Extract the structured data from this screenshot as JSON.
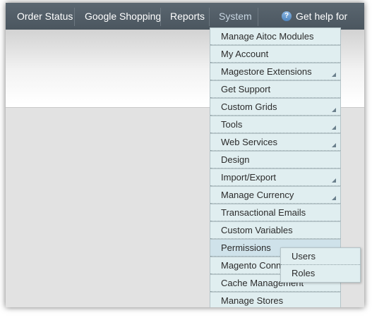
{
  "nav": {
    "order_status": "Order Status",
    "google_shopping": "Google Shopping",
    "reports": "Reports",
    "system": "System",
    "help": "Get help for",
    "help_icon_glyph": "?",
    "help_icon": "help-circle-icon"
  },
  "system_menu": {
    "items": [
      {
        "label": "Manage Aitoc Modules",
        "has_submenu": false
      },
      {
        "label": "My Account",
        "has_submenu": false
      },
      {
        "label": "Magestore Extensions",
        "has_submenu": true
      },
      {
        "label": "Get Support",
        "has_submenu": false
      },
      {
        "label": "Custom Grids",
        "has_submenu": true
      },
      {
        "label": "Tools",
        "has_submenu": true
      },
      {
        "label": "Web Services",
        "has_submenu": true
      },
      {
        "label": "Design",
        "has_submenu": false
      },
      {
        "label": "Import/Export",
        "has_submenu": true
      },
      {
        "label": "Manage Currency",
        "has_submenu": true
      },
      {
        "label": "Transactional Emails",
        "has_submenu": false
      },
      {
        "label": "Custom Variables",
        "has_submenu": false
      },
      {
        "label": "Permissions",
        "has_submenu": true
      },
      {
        "label": "Magento Connect",
        "has_submenu": true
      },
      {
        "label": "Cache Management",
        "has_submenu": false
      },
      {
        "label": "Manage Stores",
        "has_submenu": false
      }
    ]
  },
  "permissions_submenu": {
    "users": "Users",
    "roles": "Roles"
  }
}
